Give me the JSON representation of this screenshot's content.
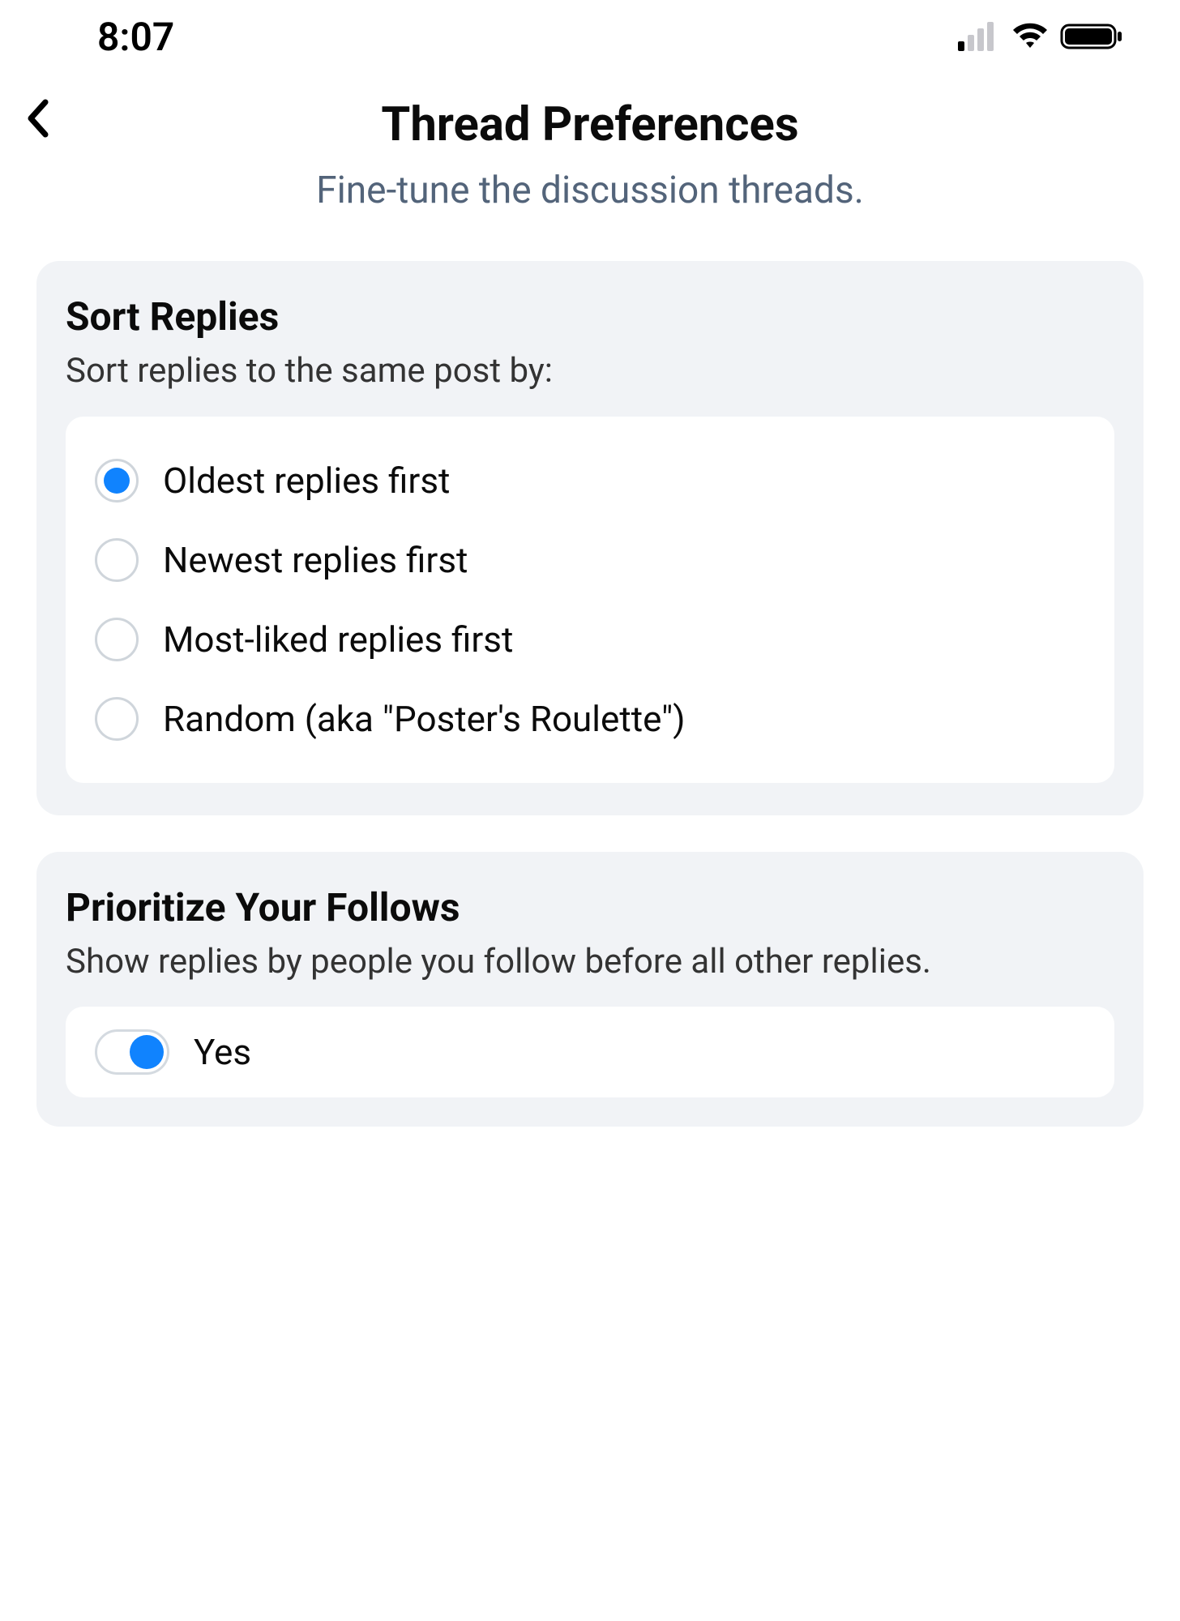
{
  "statusBar": {
    "time": "8:07"
  },
  "header": {
    "title": "Thread Preferences",
    "subtitle": "Fine-tune the discussion threads."
  },
  "sortReplies": {
    "title": "Sort Replies",
    "description": "Sort replies to the same post by:",
    "options": [
      {
        "label": "Oldest replies first",
        "selected": true
      },
      {
        "label": "Newest replies first",
        "selected": false
      },
      {
        "label": "Most-liked replies first",
        "selected": false
      },
      {
        "label": "Random (aka \"Poster's Roulette\")",
        "selected": false
      }
    ]
  },
  "prioritizeFollows": {
    "title": "Prioritize Your Follows",
    "description": "Show replies by people you follow before all other replies.",
    "enabled": true,
    "toggleLabel": "Yes"
  }
}
